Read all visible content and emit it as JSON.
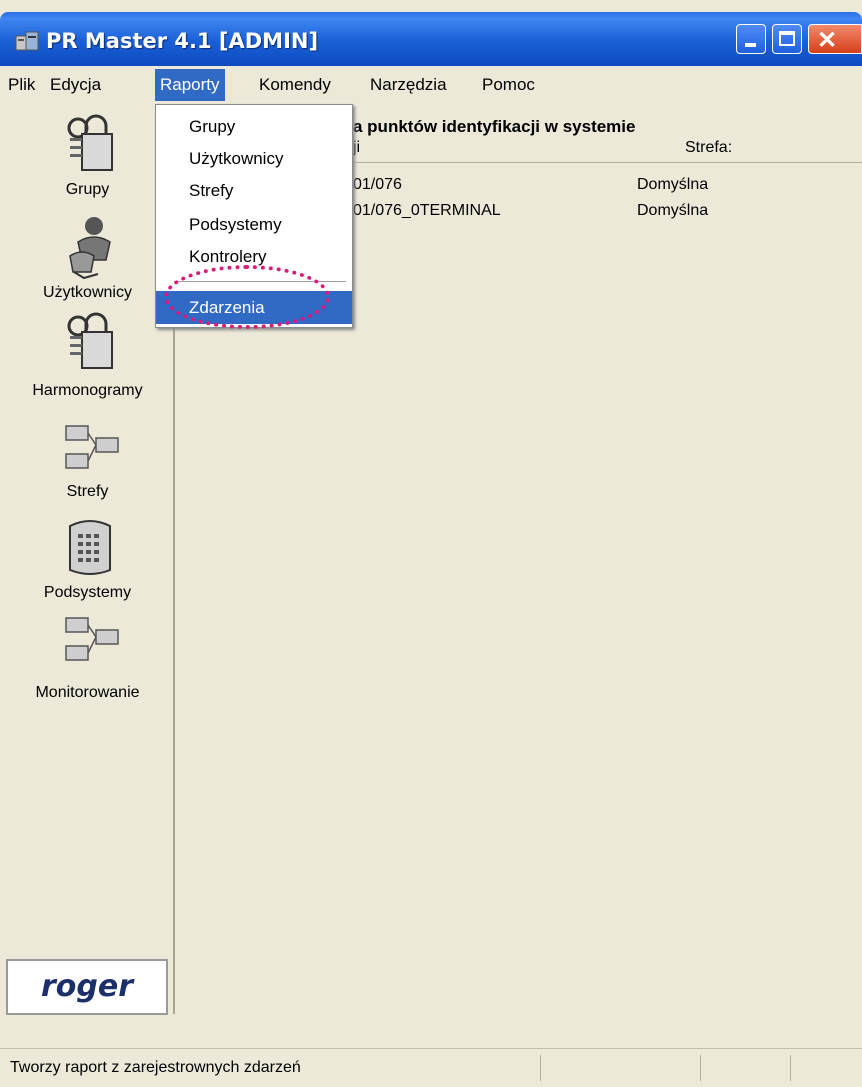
{
  "window": {
    "title": "PR Master 4.1 [ADMIN]",
    "controls": [
      "minimize-icon",
      "maximize-icon",
      "close-icon"
    ]
  },
  "menubar": {
    "items": [
      "Plik",
      "Edycja",
      "Raporty",
      "Komendy",
      "Narzędzia",
      "Pomoc"
    ],
    "active": "Raporty"
  },
  "dropdown": {
    "items": [
      "Grupy",
      "Użytkownicy",
      "Strefy",
      "Podsystemy",
      "Kontrolery",
      "Zdarzenia"
    ],
    "selected": "Zdarzenia"
  },
  "sidebar": {
    "items": [
      {
        "label": "Grupy",
        "icon": "lock-key-icon"
      },
      {
        "label": "Użytkownicy",
        "icon": "users-icon"
      },
      {
        "label": "Harmonogramy",
        "icon": "lock-key-icon"
      },
      {
        "label": "Strefy",
        "icon": "zones-icon"
      },
      {
        "label": "Podsystemy",
        "icon": "subsystem-icon"
      },
      {
        "label": "Monitorowanie",
        "icon": "zones-icon"
      }
    ],
    "logo": "roger"
  },
  "main": {
    "title_fragment": "a punktów identyfikacji w systemie",
    "col1_fragment": "ji",
    "col2_header": "Strefa:",
    "rows": [
      {
        "id": "01/076",
        "zone": "Domyślna"
      },
      {
        "id": "01/076_0TERMINAL",
        "zone": "Domyślna"
      }
    ]
  },
  "statusbar": {
    "text": "Tworzy raport z zarejestrownych zdarzeń"
  },
  "colors": {
    "titlebar": "#1a5fd6",
    "selection": "#316ac5",
    "highlight_ring": "#e0187c",
    "window_bg": "#ece9d8"
  }
}
